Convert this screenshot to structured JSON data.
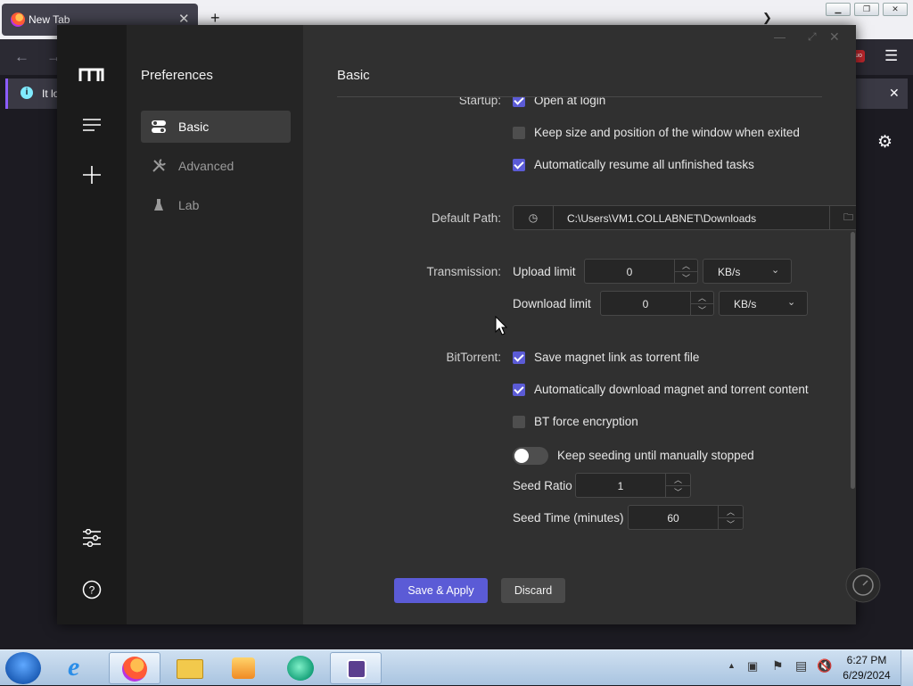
{
  "browser": {
    "tab_title": "New Tab",
    "new_tab_symbol": "+",
    "notification_text": "It lo",
    "window_controls": [
      "minimize",
      "restore",
      "close"
    ]
  },
  "motrix": {
    "sidebar_icons": [
      "motrix-logo-icon",
      "task-list-icon",
      "add-task-icon",
      "preferences-icon",
      "help-icon"
    ],
    "sub_title": "Preferences",
    "sub_items": [
      {
        "label": "Basic",
        "icon": "toggle-icon",
        "active": true
      },
      {
        "label": "Advanced",
        "icon": "tools-icon",
        "active": false
      },
      {
        "label": "Lab",
        "icon": "flask-icon",
        "active": false
      }
    ],
    "main_title": "Basic",
    "startup": {
      "label": "Startup:",
      "options": [
        {
          "label": "Open at login",
          "checked": true
        },
        {
          "label": "Keep size and position of the window when exited",
          "checked": false
        },
        {
          "label": "Automatically resume all unfinished tasks",
          "checked": true
        }
      ]
    },
    "default_path": {
      "label": "Default Path:",
      "value": "C:\\Users\\VM1.COLLABNET\\Downloads"
    },
    "transmission": {
      "label": "Transmission:",
      "upload_label": "Upload limit",
      "upload_value": "0",
      "upload_unit": "KB/s",
      "download_label": "Download limit",
      "download_value": "0",
      "download_unit": "KB/s"
    },
    "bittorrent": {
      "label": "BitTorrent:",
      "options": [
        {
          "label": "Save magnet link as torrent file",
          "checked": true
        },
        {
          "label": "Automatically download magnet and torrent content",
          "checked": true
        },
        {
          "label": "BT force encryption",
          "checked": false
        }
      ],
      "seeding_toggle_label": "Keep seeding until manually stopped",
      "seeding_toggle_on": false,
      "seed_ratio_label": "Seed Ratio",
      "seed_ratio_value": "1",
      "seed_time_label": "Seed Time (minutes)",
      "seed_time_value": "60"
    },
    "save_button": "Save & Apply",
    "discard_button": "Discard",
    "accent_color": "#5b5bd6"
  },
  "taskbar": {
    "time": "6:27 PM",
    "date": "6/29/2024",
    "apps": [
      "start-orb-icon",
      "internet-explorer-icon",
      "firefox-icon",
      "file-explorer-icon",
      "media-player-icon",
      "motrix-app-icon",
      "app-icon"
    ]
  }
}
